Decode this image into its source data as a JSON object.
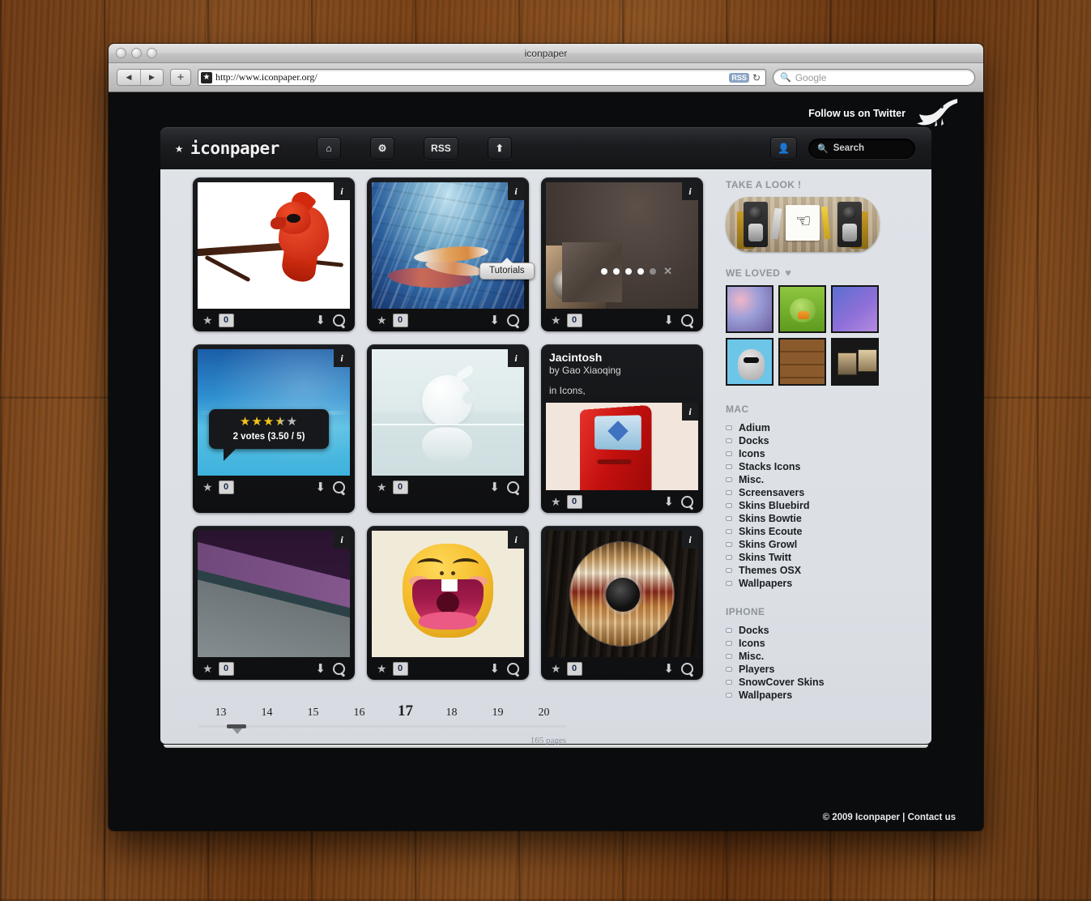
{
  "browser": {
    "window_title": "iconpaper",
    "url": "http://www.iconpaper.org/",
    "rss_label": "RSS",
    "reload_glyph": "↻",
    "search_placeholder": "Google",
    "back_glyph": "◀",
    "forward_glyph": "▶",
    "plus_glyph": "+",
    "favicon_glyph": "★",
    "search_glyph": "ⓠ"
  },
  "site": {
    "twitter_label": "Follow us on Twitter",
    "brand": "iconpaper",
    "brand_star": "★",
    "nav": [
      {
        "name": "home",
        "icon": "⌂",
        "label": ""
      },
      {
        "name": "tutorials",
        "icon": "⚙",
        "label": ""
      },
      {
        "name": "rss",
        "icon": "",
        "label": "RSS"
      },
      {
        "name": "upload",
        "icon": "⬆",
        "label": ""
      }
    ],
    "tooltip": "Tutorials",
    "account_icon": "👤",
    "search_placeholder": "Search",
    "footer": "© 2009 Iconpaper | Contact us"
  },
  "cards": [
    {
      "name": "cardinal-bird",
      "art": "bird",
      "info": "i",
      "favorites": "0",
      "download": "⬇",
      "zoom": "zoom"
    },
    {
      "name": "koi-fish",
      "art": "koi",
      "info": "i",
      "favorites": "0",
      "download": "⬇",
      "zoom": "zoom"
    },
    {
      "name": "paper-peel",
      "art": "paper",
      "info": "i",
      "favorites": "0",
      "download": "⬇",
      "zoom": "zoom",
      "slideshow": {
        "dots": 5,
        "active": 4,
        "close": "✕"
      }
    },
    {
      "name": "aurora-sky",
      "art": "aurora",
      "info": "i",
      "favorites": "0",
      "download": "⬇",
      "zoom": "zoom",
      "rating": {
        "stars_filled": 3,
        "stars_half": 1,
        "stars_total": 5,
        "text": "2 votes (3.50 / 5)"
      }
    },
    {
      "name": "apple-logo",
      "art": "apple",
      "info": "i",
      "favorites": "0",
      "download": "⬇",
      "zoom": "zoom"
    },
    {
      "name": "jacintosh",
      "art": "mac",
      "info": "i",
      "favorites": "0",
      "download": "⬇",
      "zoom": "zoom",
      "header": {
        "title": "Jacintosh",
        "author": "by Gao Xiaoqing",
        "category": "in Icons,"
      }
    },
    {
      "name": "purple-stripes",
      "art": "stripe",
      "info": "i",
      "favorites": "0",
      "download": "⬇",
      "zoom": "zoom"
    },
    {
      "name": "yellow-face",
      "art": "face",
      "info": "i",
      "favorites": "0",
      "download": "⬇",
      "zoom": "zoom"
    },
    {
      "name": "cd-disc",
      "art": "cd",
      "info": "i",
      "favorites": "0",
      "download": "⬇",
      "zoom": "zoom"
    }
  ],
  "pagination": {
    "pages": [
      "13",
      "14",
      "15",
      "16",
      "17",
      "18",
      "19",
      "20"
    ],
    "active": "17",
    "total_label": "165 pages"
  },
  "sidebar": {
    "take_a_look_title": "TAKE A LOOK !",
    "we_loved_title": "WE LOVED",
    "we_loved_heart": "♥",
    "we_loved_cells": [
      "bokeh-blur",
      "green-duck",
      "purple-gradient",
      "owl-figurine",
      "wood-planks",
      "dark-frames"
    ],
    "sections": [
      {
        "title": "MAC",
        "items": [
          "Adium",
          "Docks",
          "Icons",
          "Stacks Icons",
          "Misc.",
          "Screensavers",
          "Skins Bluebird",
          "Skins Bowtie",
          "Skins Ecoute",
          "Skins Growl",
          "Skins Twitt",
          "Themes OSX",
          "Wallpapers"
        ]
      },
      {
        "title": "IPHONE",
        "items": [
          "Docks",
          "Icons",
          "Misc.",
          "Players",
          "SnowCover Skins",
          "Wallpapers"
        ]
      }
    ]
  }
}
